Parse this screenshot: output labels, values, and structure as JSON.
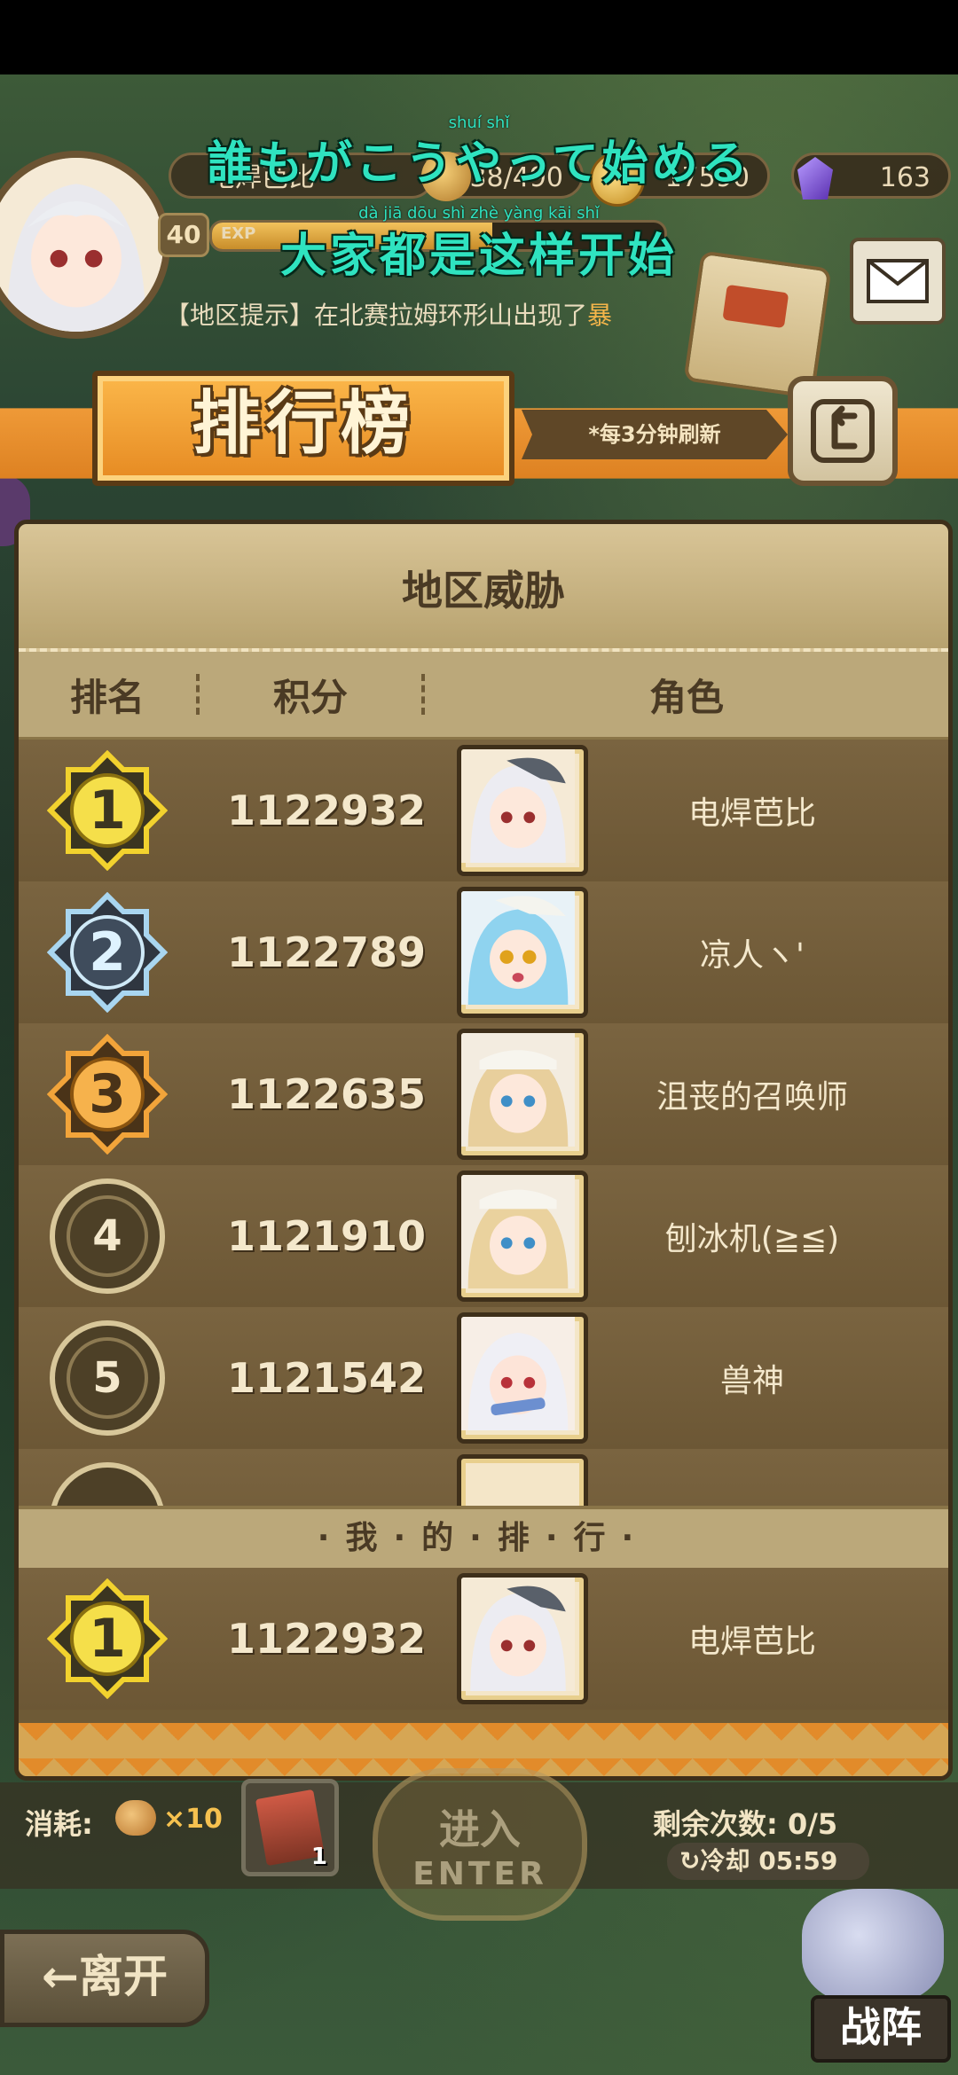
{
  "player": {
    "name": "电焊芭比",
    "level": "40",
    "exp_label": "EXP",
    "exp_fraction": 0.62,
    "stamina": "38/490",
    "gold": "17590",
    "gems": "163"
  },
  "region_hint": {
    "prefix": "【地区提示】在北赛拉姆环形山出现了",
    "accent": "暴"
  },
  "lyrics": {
    "line1": "誰もがこうやって始める",
    "line1_ruby": "shuí                                          shǐ",
    "line2": "大家都是这样开始",
    "line2_ruby": "dà   jiā   dōu   shì   zhè  yàng  kāi   shǐ"
  },
  "banner": {
    "title": "排行榜",
    "refresh_note": "*每3分钟刷新"
  },
  "board": {
    "title": "地区威胁",
    "headers": {
      "rank": "排名",
      "score": "积分",
      "character": "角色"
    },
    "rows": [
      {
        "rank": "1",
        "score": "1122932",
        "name": "电焊芭比"
      },
      {
        "rank": "2",
        "score": "1122789",
        "name": "凉人ヽ'"
      },
      {
        "rank": "3",
        "score": "1122635",
        "name": "沮丧的召唤师"
      },
      {
        "rank": "4",
        "score": "1121910",
        "name": "刨冰机(≧≦)"
      },
      {
        "rank": "5",
        "score": "1121542",
        "name": "兽神"
      }
    ],
    "my_rank_label": "·我·的·排·行·",
    "my_rank": {
      "rank": "1",
      "score": "1122932",
      "name": "电焊芭比"
    }
  },
  "bottom": {
    "cost_label": "消耗:",
    "cost_amount": "×10",
    "ticket_count": "1",
    "enter_zh": "进入",
    "enter_en": "ENTER",
    "remaining": "剩余次数: 0/5",
    "cooldown": "↻冷却 05:59",
    "leave": "←离开",
    "formation": "战阵"
  },
  "colors": {
    "gold_medal": "#f2d22e",
    "silver_medal": "#a9d6f0",
    "bronze_medal": "#f2a43a",
    "plain_medal": "#d8c79a"
  }
}
